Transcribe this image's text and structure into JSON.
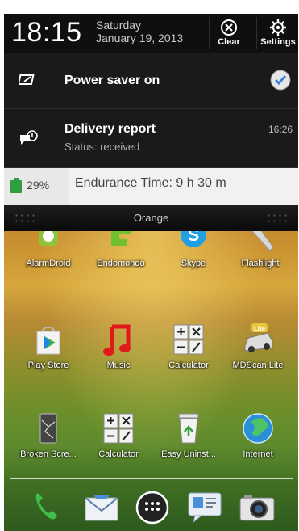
{
  "status": {
    "time": "18:15",
    "day": "Saturday",
    "date": "January 19, 2013",
    "clear_label": "Clear",
    "settings_label": "Settings"
  },
  "notifications": [
    {
      "title": "Power saver on",
      "subtitle": "",
      "time": ""
    },
    {
      "title": "Delivery report",
      "subtitle": "Status: received",
      "time": "16:26"
    }
  ],
  "battery_widget": {
    "percent": "29%",
    "endurance": "Endurance Time: 9 h 30 m"
  },
  "carrier": "Orange",
  "home": {
    "row1": [
      "AlarmDroid",
      "Endomondo",
      "Skype",
      "Flashlight"
    ],
    "row2": [
      "Play Store",
      "Music",
      "Calculator",
      "MDScan Lite"
    ],
    "row3": [
      "Broken Scre...",
      "Calculator",
      "Easy Uninst...",
      "Internet"
    ],
    "dock": [
      "phone-icon",
      "mail-icon",
      "app-drawer-icon",
      "messages-icon",
      "camera-icon"
    ]
  },
  "colors": {
    "check_blue": "#3b7fd9",
    "battery_green": "#2e9e3e"
  }
}
